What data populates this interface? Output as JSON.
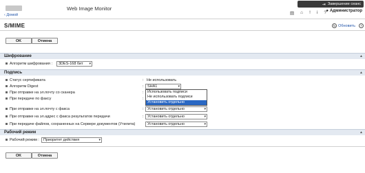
{
  "header": {
    "app_title": "Web Image Monitor",
    "logout_label": "Завершение сеанс",
    "home_link": "Домой",
    "user": "Администратор",
    "top_icons": [
      "print-icon",
      "home-icon",
      "alert-icon",
      "info-icon",
      "help-icon"
    ]
  },
  "page": {
    "title": "S/MIME",
    "refresh_label": "Обновить"
  },
  "buttons": {
    "ok": "OK",
    "cancel": "Отмена"
  },
  "encryption": {
    "title": "Шифрование",
    "algorithm_label": "Алгоритм шифрования",
    "algorithm_value": "3DES-168 бит"
  },
  "signature": {
    "title": "Подпись",
    "rows": [
      {
        "label": "Статус сертификата",
        "value": "Не использовать",
        "type": "text"
      },
      {
        "label": "Алгоритм Digest",
        "value": "SHA1",
        "type": "select"
      },
      {
        "label": "При отправке на эл.почту со сканера",
        "value": "",
        "type": "covered"
      },
      {
        "label": "При передаче по факсу",
        "value": "",
        "type": "covered"
      },
      {
        "label": "При отправке на эл.почту с факса",
        "value": "Установить отдельно",
        "type": "select"
      },
      {
        "label": "При отправке на эл.адрес с факса результатов передачи",
        "value": "Установить отдельно",
        "type": "select"
      },
      {
        "label": "При передаче файлов, сохраненных на Сервере документов (Утилита)",
        "value": "Установить отдельно",
        "type": "select"
      }
    ],
    "dropdown_options": [
      "Использовать подписи",
      "Не использовать подписи",
      "Установить отдельно"
    ],
    "dropdown_selected_index": 2
  },
  "user_mode": {
    "title": "Рабочий режим",
    "label": "Рабочий режим",
    "value": "Приоритет действия"
  },
  "colors": {
    "section_bg": "#e3e9f1",
    "selected_option": "#2a68c4",
    "link": "#2255aa"
  }
}
